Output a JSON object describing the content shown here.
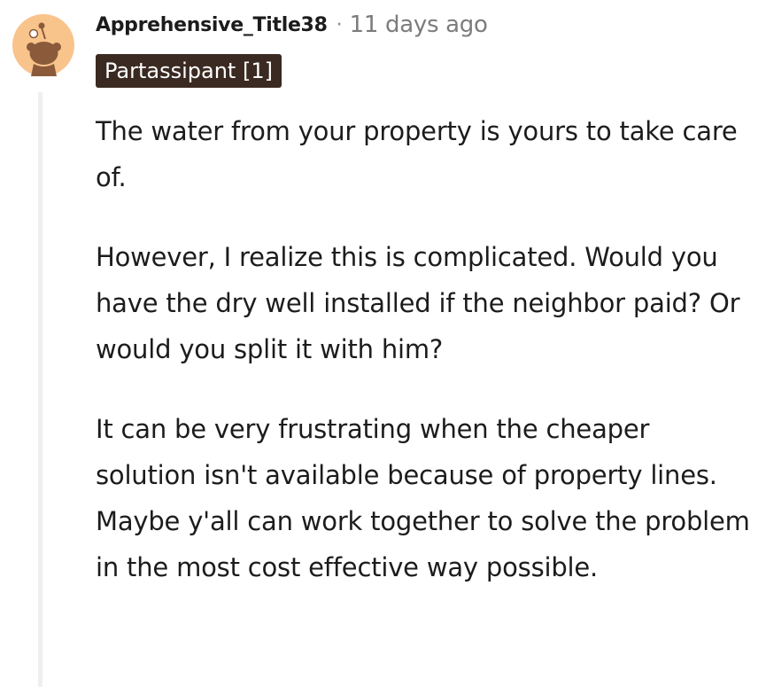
{
  "comment": {
    "username": "Apprehensive_Title38",
    "separator": "·",
    "timestamp": "11 days ago",
    "flair": "Partassipant [1]",
    "avatar_icon": "snoo-avatar-icon",
    "colors": {
      "avatar_bg": "#f9c38c",
      "avatar_fg": "#8a5a3a",
      "flair_bg": "#3a2a22",
      "flair_text": "#ffffff",
      "thread_line": "#edeff1",
      "timestamp": "#7c7c7c"
    },
    "paragraphs": [
      "The water from your property is yours to take care of.",
      "However, I realize this is complicated. Would you have the dry well installed if the neighbor paid? Or would you split it with him?",
      "It can be very frustrating when the cheaper solution isn't available because of property lines. Maybe y'all can work together to solve the problem in the most cost effective way possible."
    ]
  }
}
